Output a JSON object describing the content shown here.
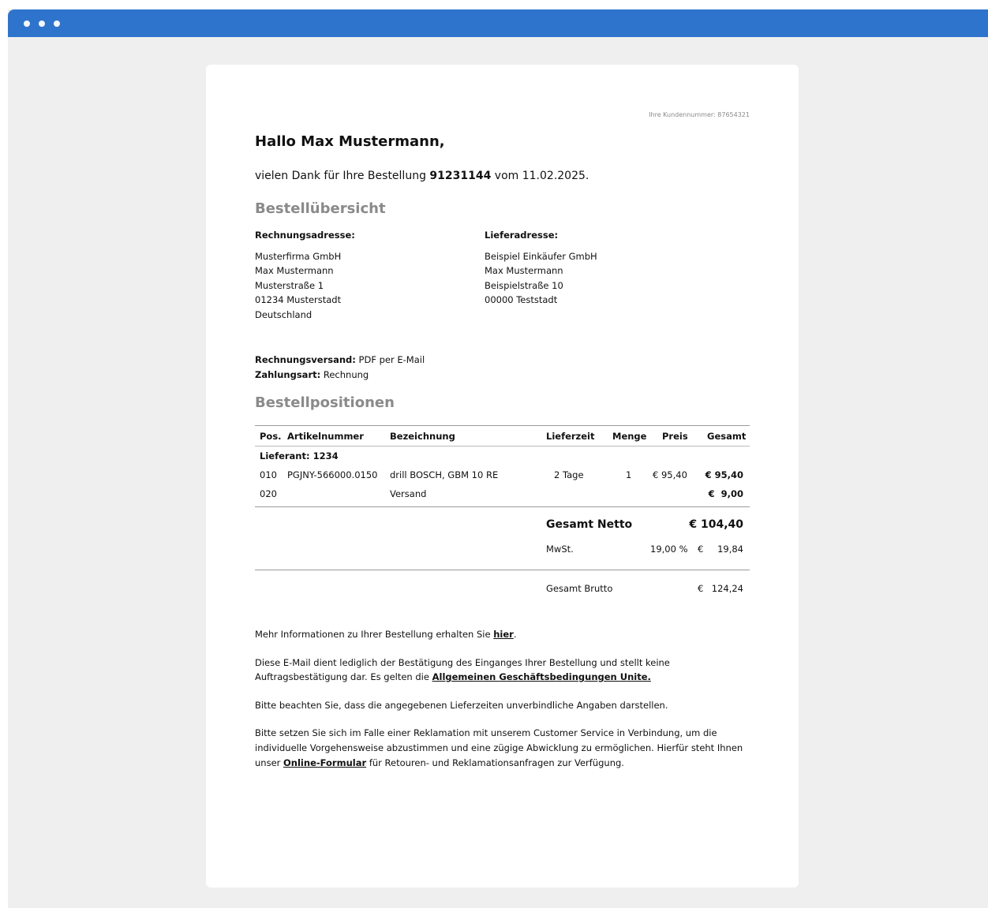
{
  "window": {
    "accent": "#2f74cc"
  },
  "email": {
    "customer_number": "Ihre Kundennummer: 87654321",
    "greeting": "Hallo Max Mustermann,",
    "thanks_prefix": "vielen Dank für Ihre Bestellung",
    "order_number": "91231144",
    "thanks_suffix": "vom 11.02.2025.",
    "overview_heading": "Bestellübersicht",
    "billing": {
      "label": "Rechnungsadresse:",
      "lines": [
        "Musterfirma GmbH",
        "Max Mustermann",
        "Musterstraße 1",
        "01234 Musterstadt",
        "Deutschland"
      ]
    },
    "shipping": {
      "label": "Lieferadresse:",
      "lines": [
        "Beispiel Einkäufer GmbH",
        "Max Mustermann",
        "Beispielstraße 10",
        "00000 Teststadt"
      ]
    },
    "invoice_delivery_label": "Rechnungsversand:",
    "invoice_delivery_value": "PDF per E-Mail",
    "payment_label": "Zahlungsart:",
    "payment_value": "Rechnung",
    "positions_heading": "Bestellpositionen",
    "table": {
      "headers": [
        "Pos.",
        "Artikelnummer",
        "Bezeichnung",
        "Lieferzeit",
        "Menge",
        "Preis",
        "Gesamt"
      ],
      "supplier": "Lieferant: 1234",
      "rows": [
        {
          "pos": "010",
          "article": "PGJNY-566000.0150",
          "desc": "drill BOSCH, GBM 10 RE",
          "time": "2 Tage",
          "qty": "1",
          "price": "€ 95,40",
          "total": "€ 95,40"
        },
        {
          "pos": "020",
          "article": "",
          "desc": "Versand",
          "time": "",
          "qty": "",
          "price": "",
          "total": "€  9,00"
        }
      ],
      "net_label": "Gesamt Netto",
      "net_value": "€ 104,40",
      "vat_label": "MwSt.",
      "vat_rate": "19,00 %",
      "vat_currency": "€",
      "vat_value": "19,84",
      "gross_label": "Gesamt Brutto",
      "gross_currency": "€",
      "gross_value": "124,24"
    },
    "footer": {
      "info_prefix": "Mehr Informationen zu Ihrer Bestellung erhalten Sie",
      "info_link": "hier",
      "info_suffix": ".",
      "confirm_line1": "Diese E-Mail dient lediglich der Bestätigung des Einganges Ihrer Bestellung und stellt keine",
      "confirm_line2_prefix": "Auftragsbestätigung dar. Es gelten die",
      "agb_link": "Allgemeinen Geschäftsbedingungen Unite.",
      "delivery_note": "Bitte beachten Sie, dass die angegebenen Lieferzeiten unverbindliche Angaben darstellen.",
      "complaint_line1": "Bitte setzen Sie sich im Falle einer Reklamation mit unserem Customer Service in Verbindung, um die",
      "complaint_line2": "individuelle Vorgehensweise abzustimmen und eine zügige Abwicklung zu ermöglichen. Hierfür steht Ihnen",
      "complaint_line3_prefix": "unser",
      "form_link": "Online-Formular",
      "complaint_line3_suffix": "für Retouren- und Reklamationsanfragen zur Verfügung."
    }
  }
}
